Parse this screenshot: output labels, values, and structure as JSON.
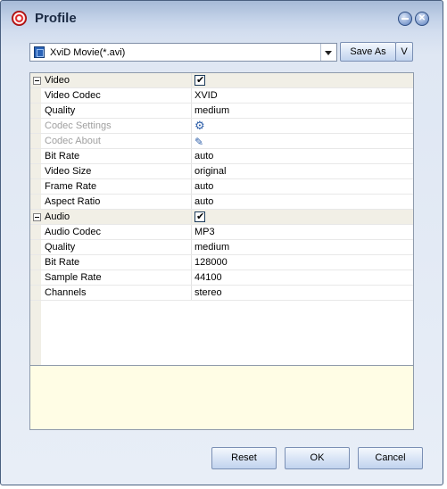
{
  "window": {
    "title": "Profile"
  },
  "profile": {
    "selected": "XviD Movie(*.avi)"
  },
  "buttons": {
    "save_as": "Save As",
    "v": "V",
    "reset": "Reset",
    "ok": "OK",
    "cancel": "Cancel"
  },
  "grid": {
    "video": {
      "label": "Video",
      "enabled": true,
      "rows": [
        {
          "name": "Video Codec",
          "value": "XVID"
        },
        {
          "name": "Quality",
          "value": "medium"
        },
        {
          "name": "Codec Settings",
          "value": "",
          "icon": "gear-icon",
          "disabled": true
        },
        {
          "name": "Codec About",
          "value": "",
          "icon": "edit-icon",
          "disabled": true
        },
        {
          "name": "Bit Rate",
          "value": "auto"
        },
        {
          "name": "Video Size",
          "value": "original"
        },
        {
          "name": "Frame Rate",
          "value": "auto"
        },
        {
          "name": "Aspect Ratio",
          "value": "auto"
        }
      ]
    },
    "audio": {
      "label": "Audio",
      "enabled": true,
      "rows": [
        {
          "name": "Audio Codec",
          "value": "MP3"
        },
        {
          "name": "Quality",
          "value": "medium"
        },
        {
          "name": "Bit Rate",
          "value": "128000"
        },
        {
          "name": "Sample Rate",
          "value": "44100"
        },
        {
          "name": "Channels",
          "value": "stereo"
        }
      ]
    }
  },
  "description": ""
}
